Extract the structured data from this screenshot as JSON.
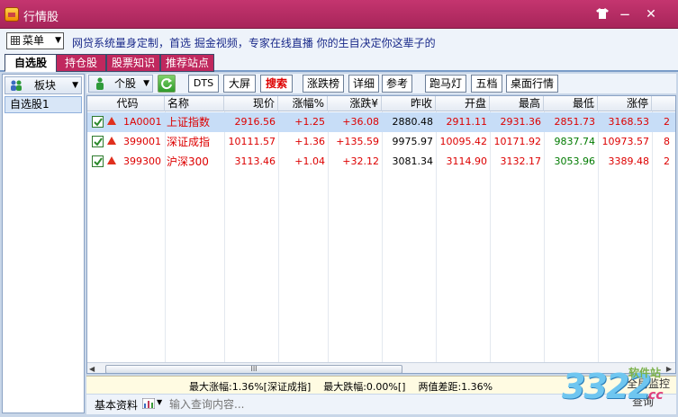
{
  "window": {
    "title": "行情股"
  },
  "menu": {
    "label": "菜单",
    "marquee": "网贷系统量身定制，首选  掘金视频，专家在线直播   你的生自决定你这辈子的"
  },
  "tabs": [
    {
      "label": "自选股",
      "active": true
    },
    {
      "label": "持仓股",
      "active": false
    },
    {
      "label": "股票知识",
      "active": false
    },
    {
      "label": "推荐站点",
      "active": false
    }
  ],
  "sidebar": {
    "board_label": "板块",
    "items": [
      {
        "label": "自选股1"
      }
    ]
  },
  "toolbar": {
    "stock_type": "个股",
    "buttons": [
      "DTS",
      "大屏",
      "搜索",
      "涨跌榜",
      "详细",
      "参考",
      "跑马灯",
      "五档",
      "桌面行情"
    ]
  },
  "table": {
    "headers": [
      "代码",
      "名称",
      "现价",
      "涨幅%",
      "涨跌¥",
      "昨收",
      "开盘",
      "最高",
      "最低",
      "涨停"
    ],
    "rows": [
      {
        "checked": true,
        "code": "1A0001",
        "name": "上证指数",
        "price": "2916.56",
        "change_pct": "+1.25",
        "change": "+36.08",
        "prev_close": "2880.48",
        "open": "2911.11",
        "high": "2931.36",
        "low": "2851.73",
        "limit_up": "3168.53",
        "extra": "2",
        "selected": true
      },
      {
        "checked": true,
        "code": "399001",
        "name": "深证成指",
        "price": "10111.57",
        "change_pct": "+1.36",
        "change": "+135.59",
        "prev_close": "9975.97",
        "open": "10095.42",
        "high": "10171.92",
        "low": "9837.74",
        "limit_up": "10973.57",
        "extra": "8",
        "selected": false
      },
      {
        "checked": true,
        "code": "399300",
        "name": "沪深300",
        "price": "3113.46",
        "change_pct": "+1.04",
        "change": "+32.12",
        "prev_close": "3081.34",
        "open": "3114.90",
        "high": "3132.17",
        "low": "3053.96",
        "limit_up": "3389.48",
        "extra": "2",
        "selected": false
      }
    ]
  },
  "scrollbar": {
    "thumb_label": "III"
  },
  "status": {
    "text": "最大涨幅:1.36%[深证成指]    最大跌幅:0.00%[]    两值差距:1.36%"
  },
  "bottom": {
    "basic_info": "基本资料",
    "query_placeholder": "输入查询内容..."
  },
  "watermark": {
    "number": "3322",
    "site": "软件站",
    "domain": "cc",
    "text1": "全局监控",
    "text2": "查询"
  },
  "colors": {
    "titlebar": "#b52c63",
    "tab_inactive": "#c0285e",
    "up": "#dd0000",
    "selected_row": "#c7ddf7",
    "status_bg": "#fffbe2"
  }
}
